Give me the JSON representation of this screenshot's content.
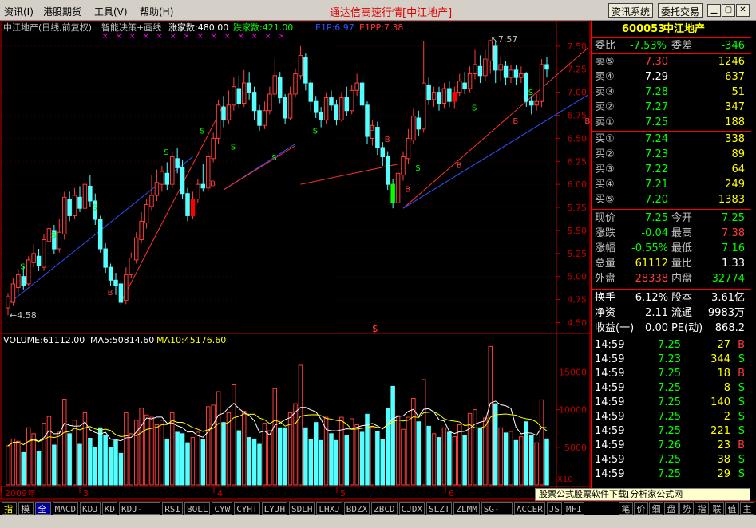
{
  "menu": {
    "items": [
      "资讯(I)",
      "港股期货",
      "工具(V)",
      "帮助(H)"
    ],
    "app_title": "通达信高速行情",
    "stock_bracket": "[中江地产]",
    "btn_info": "资讯系统",
    "btn_trade": "委托交易"
  },
  "chart": {
    "header_name": "中江地产(日线,前复权)",
    "header_indicator": "智能决策+画线",
    "up_count": "涨家数:480.00",
    "down_count": "跌家数:421.00",
    "e1p": "E1P:6.97",
    "e1pp": "E1PP:7.38",
    "price_ticks": [
      "7.50",
      "7.25",
      "7.00",
      "6.75",
      "6.50",
      "6.25",
      "6.00",
      "5.75",
      "5.50",
      "5.25",
      "5.00",
      "4.75",
      "4.50"
    ],
    "high_label": "7.57",
    "low_label": "4.58",
    "volume_header": "VOLUME:61112.00",
    "ma5_header": "MA5:50814.60",
    "ma10_header": "MA10:45176.60",
    "volume_ticks": [
      "15000",
      "10000",
      "5000"
    ],
    "vol_unit": "X10",
    "months": [
      "2009年",
      "3",
      "4",
      "5",
      "6"
    ],
    "signals": {
      "s": "S",
      "b": "B",
      "dollar": "$"
    }
  },
  "colors": {
    "up": "#ff3c3c",
    "down": "#54ffff",
    "ma5": "#ffffff",
    "ma10": "#ffff00",
    "axis": "#c00000",
    "yellow": "#ffff00",
    "green": "#00ff00",
    "red": "#ff3c3c"
  },
  "panel": {
    "code": "600053",
    "name": "中江地产",
    "weibi_label": "委比",
    "weibi_val": "-7.53%",
    "weicha_label": "委差",
    "weicha_val": "-346",
    "asks": [
      {
        "label": "卖⑤",
        "price": "7.30",
        "vol": "1246"
      },
      {
        "label": "卖④",
        "price": "7.29",
        "vol": "637"
      },
      {
        "label": "卖③",
        "price": "7.28",
        "vol": "51"
      },
      {
        "label": "卖②",
        "price": "7.27",
        "vol": "347"
      },
      {
        "label": "卖①",
        "price": "7.25",
        "vol": "188"
      }
    ],
    "bids": [
      {
        "label": "买①",
        "price": "7.24",
        "vol": "338"
      },
      {
        "label": "买②",
        "price": "7.23",
        "vol": "89"
      },
      {
        "label": "买③",
        "price": "7.22",
        "vol": "64"
      },
      {
        "label": "买④",
        "price": "7.21",
        "vol": "249"
      },
      {
        "label": "买⑤",
        "price": "7.20",
        "vol": "1383"
      }
    ],
    "quote": [
      {
        "l1": "现价",
        "v1": "7.25",
        "c1": "#00ff00",
        "l2": "今开",
        "v2": "7.25",
        "c2": "#00ff00"
      },
      {
        "l1": "涨跌",
        "v1": "-0.04",
        "c1": "#00ff00",
        "l2": "最高",
        "v2": "7.38",
        "c2": "#ff3c3c"
      },
      {
        "l1": "涨幅",
        "v1": "-0.55%",
        "c1": "#00ff00",
        "l2": "最低",
        "v2": "7.16",
        "c2": "#00ff00"
      },
      {
        "l1": "总量",
        "v1": "61112",
        "c1": "#ffff00",
        "l2": "量比",
        "v2": "1.33",
        "c2": "#ffffff"
      },
      {
        "l1": "外盘",
        "v1": "28338",
        "c1": "#ff3c3c",
        "l2": "内盘",
        "v2": "32774",
        "c2": "#00ff00"
      }
    ],
    "fin": [
      {
        "l1": "换手",
        "v1": "6.12%",
        "l2": "股本",
        "v2": "3.61亿"
      },
      {
        "l1": "净资",
        "v1": "2.11",
        "l2": "流通",
        "v2": "9983万"
      },
      {
        "l1": "收益(一)",
        "v1": "0.00",
        "l2": "PE(动)",
        "v2": "868.2"
      }
    ],
    "ticks": [
      {
        "t": "14:59",
        "p": "7.25",
        "v": "27",
        "d": "B"
      },
      {
        "t": "14:59",
        "p": "7.23",
        "v": "344",
        "d": "S"
      },
      {
        "t": "14:59",
        "p": "7.25",
        "v": "18",
        "d": "B"
      },
      {
        "t": "14:59",
        "p": "7.25",
        "v": "8",
        "d": "S"
      },
      {
        "t": "14:59",
        "p": "7.25",
        "v": "140",
        "d": "S"
      },
      {
        "t": "14:59",
        "p": "7.25",
        "v": "2",
        "d": "S"
      },
      {
        "t": "14:59",
        "p": "7.25",
        "v": "221",
        "d": "S"
      },
      {
        "t": "14:59",
        "p": "7.26",
        "v": "23",
        "d": "B"
      },
      {
        "t": "14:59",
        "p": "7.25",
        "v": "38",
        "d": "S"
      },
      {
        "t": "14:59",
        "p": "7.25",
        "v": "29",
        "d": "S"
      }
    ]
  },
  "ad": "股票公式股票软件下载[分析家公式网www.88gs.com]",
  "tabs": [
    "指标",
    "模板",
    "全部",
    "MACD",
    "KDJ",
    "KD",
    "KDJ-TDX",
    "RSI",
    "BOLL",
    "CYW",
    "CYHT",
    "LYJH",
    "SDLH",
    "LHXJ",
    "BDZX",
    "ZBCD",
    "CJDX",
    "SLZT",
    "ZLMM",
    "SG-LB",
    "ACCER",
    "JS",
    "MFI"
  ],
  "right_tabs": [
    "笔",
    "价",
    "细",
    "盘",
    "势",
    "指",
    "联",
    "值",
    "主"
  ]
}
